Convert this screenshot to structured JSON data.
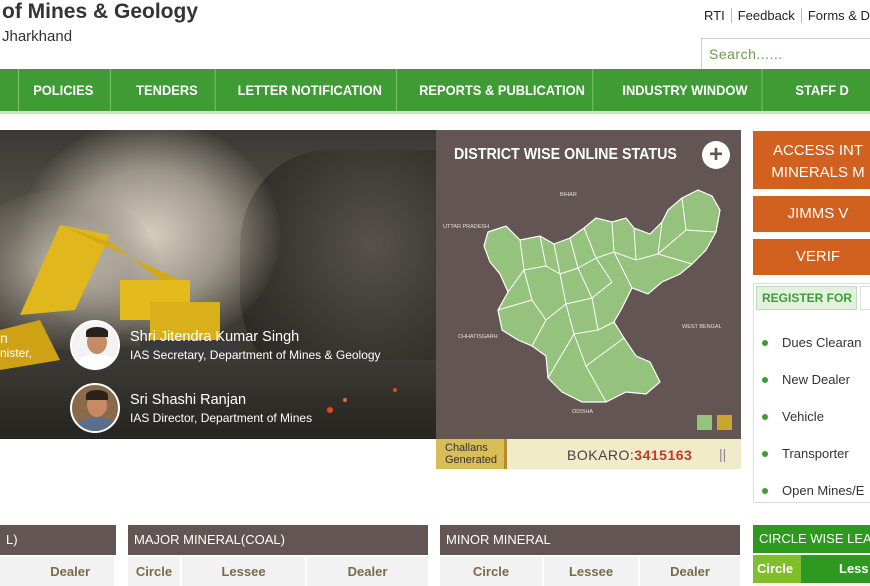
{
  "header": {
    "title": "of Mines & Geology",
    "subtitle": "Jharkhand",
    "links": [
      "RTI",
      "Feedback",
      "Forms & D"
    ],
    "search_placeholder": "Search......"
  },
  "nav": {
    "items": [
      "POLICIES",
      "TENDERS",
      "LETTER NOTIFICATION",
      "REPORTS & PUBLICATION",
      "INDUSTRY WINDOW",
      "STAFF D"
    ]
  },
  "banner": {
    "partial_name": "n",
    "partial_role": "nister,",
    "people": [
      {
        "name": "Shri Jitendra Kumar Singh",
        "role": "IAS Secretary, Department of Mines & Geology"
      },
      {
        "name": "Sri Shashi Ranjan",
        "role": "IAS Director, Department of Mines"
      }
    ]
  },
  "district": {
    "title": "DISTRICT WISE ONLINE STATUS",
    "plus": "+",
    "map_labels": [
      "BIHAR",
      "UTTAR PRADESH",
      "CHHATISGARH",
      "WEST BENGAL",
      "ODISHA"
    ],
    "legend_colors": [
      "#95c37d",
      "#c9a62e"
    ],
    "challan_label_line1": "Challans",
    "challan_label_line2": "Generated",
    "challan_district": "BOKARO:",
    "challan_value": "3415163",
    "pause": "||"
  },
  "right": {
    "btn1_line1": "ACCESS INT",
    "btn1_line2": "MINERALS M",
    "btn2": "JIMMS V",
    "btn3": "VERIF",
    "register_tab": "REGISTER FOR",
    "register_items": [
      "Dues Clearan",
      "New Dealer",
      "Vehicle",
      "Transporter",
      "Open Mines/E"
    ],
    "circle_lease_title": "CIRCLE WISE LEA",
    "circle_col": "Circle",
    "lessee_col": "Less"
  },
  "tables": [
    {
      "title": "L)",
      "cols": [
        "Dealer"
      ]
    },
    {
      "title": "MAJOR MINERAL(COAL)",
      "cols": [
        "Circle",
        "Lessee",
        "Dealer"
      ]
    },
    {
      "title": "MINOR MINERAL",
      "cols": [
        "Circle",
        "Lessee",
        "Dealer"
      ]
    }
  ]
}
